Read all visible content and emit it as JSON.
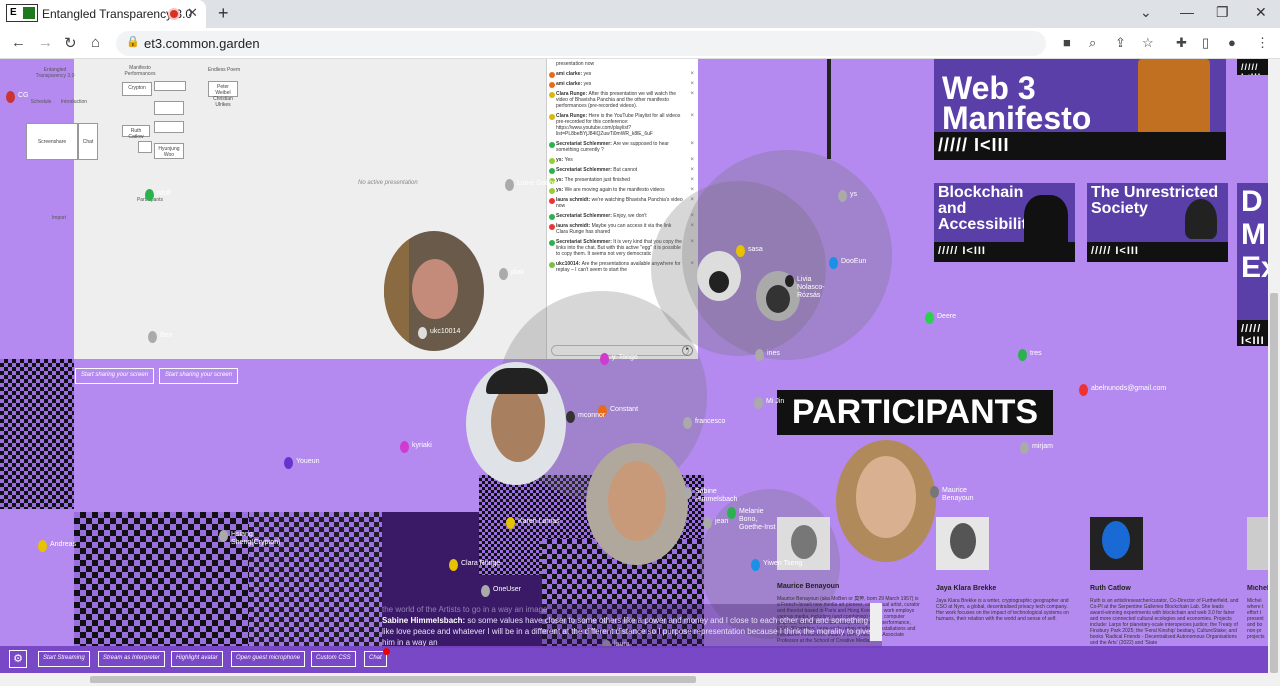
{
  "browser": {
    "tab_title": "Entangled Transparency 3.0",
    "favicon_text": "E",
    "url": "et3.common.garden"
  },
  "whiteboard": {
    "labels": [
      "Entangled Transparency 3.0",
      "Manifesto Performances",
      "Endless Poem",
      "Schedule",
      "Introduction",
      "Screenshare",
      "Chat",
      "Crypton",
      "Peter Weibel Christian Ulrikes",
      "Ruth Catlow",
      "Hyunjung Woo",
      "Import",
      "Participants"
    ],
    "no_presentation": "No active presentation",
    "share_button": "Start sharing your screen"
  },
  "chat": {
    "messages": [
      {
        "author": "",
        "text": "presentation now",
        "color": ""
      },
      {
        "author": "ami clarke:",
        "text": "yes",
        "color": "#e86b1c"
      },
      {
        "author": "ami clarke:",
        "text": "yes",
        "color": "#e86b1c"
      },
      {
        "author": "Clara Runge:",
        "text": "After this presentation we will watch the video of Bhavisha Panchia and the other manifesto performances (pre-recorded videos).",
        "color": "#d6b90a"
      },
      {
        "author": "Clara Runge:",
        "text": "Here is the YouTube Playlist for all videos pre-recorded for this conference: https://www.youtube.com/playlist?list=PL8beBYjJ84lQZuwTi0mWR_k8lE_6uF",
        "color": "#d6b90a"
      },
      {
        "author": "Secretariat Schlemmer:",
        "text": "Are we supposed to hear something currently ?",
        "color": "#2bb24c"
      },
      {
        "author": "ys:",
        "text": "Yes",
        "color": "#9acd32"
      },
      {
        "author": "Secretariat Schlemmer:",
        "text": "But cannot",
        "color": "#2bb24c"
      },
      {
        "author": "ys:",
        "text": "The presentation just finished",
        "color": "#9acd32"
      },
      {
        "author": "ys:",
        "text": "We are moving again to the manifesto videos",
        "color": "#9acd32"
      },
      {
        "author": "laura schmidt:",
        "text": "we're watching Bhavisha Panchia's video now",
        "color": "#e33"
      },
      {
        "author": "Secretariat Schlemmer:",
        "text": "Enjoy, we don't",
        "color": "#2bb24c"
      },
      {
        "author": "laura schmidt:",
        "text": "Maybe you can access it via the link Clara Runge has shared",
        "color": "#e33"
      },
      {
        "author": "Secretariat Schlemmer:",
        "text": "It is very kind that you copy the links into the chat. But with this active \"egg\" it is possible to copy them. It seems not very democratic",
        "color": "#2bb24c"
      },
      {
        "author": "ukc10014:",
        "text": "Are the presentations available anywhere for replay – I can't seem to start the",
        "color": "#7ac143"
      }
    ],
    "input_placeholder": "",
    "send_icon": "send-icon"
  },
  "avatars": [
    {
      "name": "CG",
      "color": "#c33"
    },
    {
      "name": "Lione Gabbs",
      "color": "#aaa"
    },
    {
      "name": "rdolf",
      "color": "#2bb24c"
    },
    {
      "name": "ukc10014",
      "color": "#ddd"
    },
    {
      "name": "plak",
      "color": "#aaa"
    },
    {
      "name": "Ben",
      "color": "#aaa"
    },
    {
      "name": "ys",
      "color": "#aaa"
    },
    {
      "name": "sasa",
      "color": "#e6c200"
    },
    {
      "name": "DooEun",
      "color": "#1a90e6"
    },
    {
      "name": "Livia Nolasco-Rózsás",
      "color": "#222"
    },
    {
      "name": "Deere",
      "color": "#2bd04c"
    },
    {
      "name": "ines",
      "color": "#aaa"
    },
    {
      "name": "tres",
      "color": "#2bb24c"
    },
    {
      "name": "abelnunods@gmail.com",
      "color": "#e33"
    },
    {
      "name": "y. Tongo",
      "color": "#d03ad0"
    },
    {
      "name": "Constant",
      "color": "#e86b1c"
    },
    {
      "name": "mconnor",
      "color": "#333"
    },
    {
      "name": "francesco",
      "color": "#aaa"
    },
    {
      "name": "Mi Jin",
      "color": "#aaa"
    },
    {
      "name": "kyriaki",
      "color": "#d03ad0"
    },
    {
      "name": "Youeun",
      "color": "#6633cc"
    },
    {
      "name": "mirjam",
      "color": "#aaa"
    },
    {
      "name": "Maurice Benayoun",
      "color": "#777"
    },
    {
      "name": "Sabine Himmelsbach",
      "color": "#aaa"
    },
    {
      "name": "Melanie Bono, Goethe-Inst",
      "color": "#2bb24c"
    },
    {
      "name": "Karen Lamas",
      "color": "#e6c200"
    },
    {
      "name": "jean",
      "color": "#aaa"
    },
    {
      "name": "Yiwen Tseng",
      "color": "#1a90e6"
    },
    {
      "name": "Hsiang Sheng(Crypton)",
      "color": "#aaa"
    },
    {
      "name": "Andreas",
      "color": "#e6c200"
    },
    {
      "name": "Clara Runge",
      "color": "#e6c200"
    },
    {
      "name": "OneUser",
      "color": "#aaa"
    },
    {
      "name": "laura",
      "color": "#aaa"
    }
  ],
  "banners": {
    "top": "Web 3 Manifesto",
    "b1": "Blockchain and Accessibility",
    "b2": "The Unrestricted Society",
    "b3": "D M Ex",
    "stripe": "///// I<III"
  },
  "participants": {
    "heading": "PARTICIPANTS",
    "people": [
      {
        "name": "Maurice Benayoun",
        "bio": "Maurice Benayoun (aka MoBen or 莫奔, born 29 March 1957) is a French-Israeli new media art pioneer, conceptual artist, curator and theorist based in Paris and Hong Kong. His work employs various media, including (and combining) video, computer graphics, immersive virtual reality, the Internet, performance, EEG, 3D printing, large-scale urban media art installations and interactive exhibitions. Maurice Benayoun is an Associate Professor at the School of Creative Media"
      },
      {
        "name": "Jaya Klara Brekke",
        "bio": "Jaya Klara Brekke is a writer, cryptographic geographer and CSO at Nym, a global, decentralised privacy tech company. Her work focuses on the impact of technological systems on humans, their relation with the world and sense of self."
      },
      {
        "name": "Ruth Catlow",
        "bio": "Ruth is an artist/researcher/curator, Co-Director of Furtherfield, and Co-PI at the Serpentine Galleries Blockchain Lab. She leads award-winning experiments with blockchain and web 3.0 for fairer and more connected cultural ecologies and economies. Projects include: Larps for planetary-scale interspecies justice; the Treaty of Finsbury Park 2025; the 'Feral Kinship' bestiary, CultureStake; and books 'Radical Friends - Decentralised Autonomous Organisations and the Arts' (2022) and 'State"
      },
      {
        "name": "Michel",
        "bio": "Michel where t effort t present and bo non-pr projects"
      }
    ]
  },
  "subtitles": {
    "line0": "the world of the Artists to go in a way an image",
    "speaker": "Sabine Himmelsbach:",
    "text": "so some values have closer to some others like a power and money and I close to each other and and something like love peace and whatever I will be in a different at the different distance so I purpose representation because I think the morality to give him in a way an"
  },
  "bottom_bar": {
    "settings_icon": "gear-icon",
    "start_streaming": "Start Streaming",
    "stream_interpreter": "Stream as Interpreter",
    "highlight_avatar": "Highlight avatar",
    "open_guest_mic": "Open guest microphone",
    "custom_css": "Custom CSS",
    "chat": "Chat"
  },
  "colors": {
    "background": "#b58af0",
    "accent": "#5b3fa8",
    "record": "#d93025"
  }
}
